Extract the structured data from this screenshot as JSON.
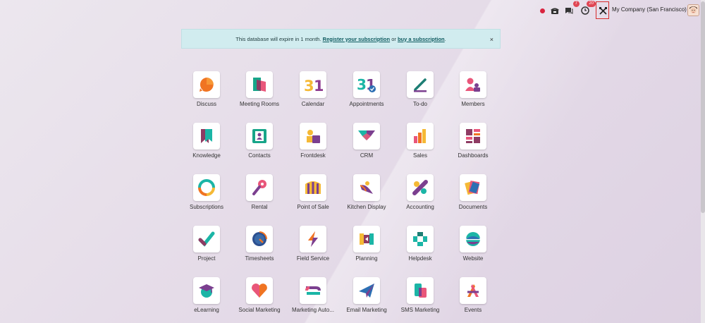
{
  "topbar": {
    "chat_badge": "7",
    "activity_badge": "20",
    "company": "My Company (San Francisco)"
  },
  "banner": {
    "text_before": "This database will expire in 1 month.",
    "link_register": "Register your subscription",
    "text_or": "or",
    "link_buy": "buy a subscription",
    "text_after": ".",
    "close": "×"
  },
  "apps": [
    {
      "label": "Discuss",
      "icon": "discuss-icon"
    },
    {
      "label": "Meeting Rooms",
      "icon": "meeting-rooms-icon"
    },
    {
      "label": "Calendar",
      "icon": "calendar-icon"
    },
    {
      "label": "Appointments",
      "icon": "appointments-icon"
    },
    {
      "label": "To-do",
      "icon": "todo-icon"
    },
    {
      "label": "Members",
      "icon": "members-icon"
    },
    {
      "label": "Knowledge",
      "icon": "knowledge-icon"
    },
    {
      "label": "Contacts",
      "icon": "contacts-icon"
    },
    {
      "label": "Frontdesk",
      "icon": "frontdesk-icon"
    },
    {
      "label": "CRM",
      "icon": "crm-icon"
    },
    {
      "label": "Sales",
      "icon": "sales-icon"
    },
    {
      "label": "Dashboards",
      "icon": "dashboards-icon"
    },
    {
      "label": "Subscriptions",
      "icon": "subscriptions-icon"
    },
    {
      "label": "Rental",
      "icon": "rental-icon"
    },
    {
      "label": "Point of Sale",
      "icon": "point-of-sale-icon"
    },
    {
      "label": "Kitchen Display",
      "icon": "kitchen-display-icon"
    },
    {
      "label": "Accounting",
      "icon": "accounting-icon"
    },
    {
      "label": "Documents",
      "icon": "documents-icon"
    },
    {
      "label": "Project",
      "icon": "project-icon"
    },
    {
      "label": "Timesheets",
      "icon": "timesheets-icon"
    },
    {
      "label": "Field Service",
      "icon": "field-service-icon"
    },
    {
      "label": "Planning",
      "icon": "planning-icon"
    },
    {
      "label": "Helpdesk",
      "icon": "helpdesk-icon"
    },
    {
      "label": "Website",
      "icon": "website-icon"
    },
    {
      "label": "eLearning",
      "icon": "elearning-icon"
    },
    {
      "label": "Social Marketing",
      "icon": "social-marketing-icon"
    },
    {
      "label": "Marketing Auto...",
      "icon": "marketing-automation-icon"
    },
    {
      "label": "Email Marketing",
      "icon": "email-marketing-icon"
    },
    {
      "label": "SMS Marketing",
      "icon": "sms-marketing-icon"
    },
    {
      "label": "Events",
      "icon": "events-icon"
    }
  ],
  "colors": {
    "orange": "#f06b2c",
    "teal": "#1bb5a6",
    "purple": "#7b3f8f",
    "magenta": "#c2185b",
    "yellow": "#f5b935",
    "blue": "#2c6fb3",
    "highlight": "#d62c2c"
  }
}
